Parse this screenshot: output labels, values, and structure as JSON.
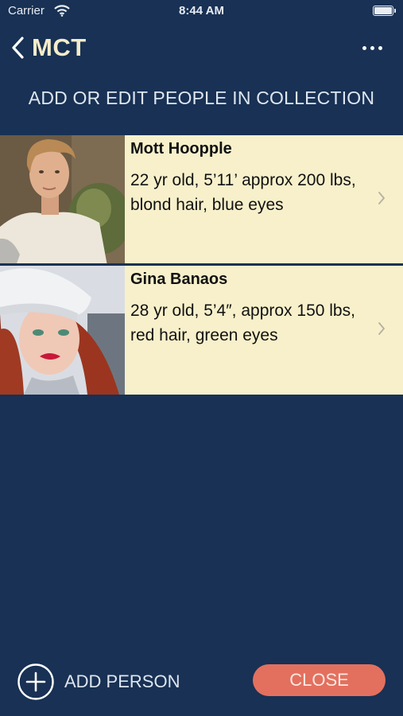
{
  "status_bar": {
    "carrier": "Carrier",
    "time": "8:44 AM"
  },
  "nav": {
    "title": "MCT",
    "back_icon": "chevron-left-icon",
    "more_icon": "ellipsis-icon"
  },
  "heading": "ADD OR EDIT PEOPLE IN COLLECTION",
  "people": [
    {
      "name": "Mott Hoopple",
      "description": "22 yr old, 5’11’ approx 200 lbs, blond hair, blue eyes"
    },
    {
      "name": "Gina Banaos",
      "description": "28 yr old, 5’4″, approx 150 lbs, red hair, green eyes"
    }
  ],
  "footer": {
    "add_label": "ADD PERSON",
    "close_label": "CLOSE"
  },
  "colors": {
    "background": "#183154",
    "row_background": "#f7f0cb",
    "title": "#f5eccb",
    "close_button": "#e3705f"
  }
}
